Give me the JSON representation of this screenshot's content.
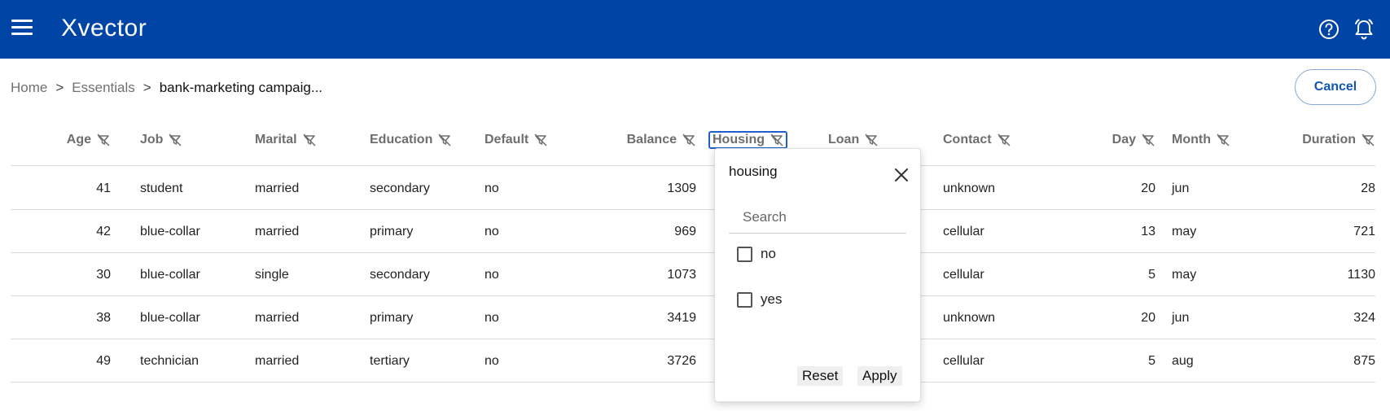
{
  "app": {
    "logo": "Xvector"
  },
  "breadcrumb": {
    "home": "Home",
    "sep": ">",
    "essentials": "Essentials",
    "current": "bank-marketing campaig..."
  },
  "actions": {
    "cancel": "Cancel"
  },
  "table": {
    "columns": [
      "Age",
      "Job",
      "Marital",
      "Education",
      "Default",
      "Balance",
      "Housing",
      "Loan",
      "Contact",
      "Day",
      "Month",
      "Duration"
    ],
    "rows": [
      [
        "41",
        "student",
        "married",
        "secondary",
        "no",
        "1309",
        "",
        "",
        "unknown",
        "20",
        "jun",
        "28"
      ],
      [
        "42",
        "blue-collar",
        "married",
        "primary",
        "no",
        "969",
        "",
        "",
        "cellular",
        "13",
        "may",
        "721"
      ],
      [
        "30",
        "blue-collar",
        "single",
        "secondary",
        "no",
        "1073",
        "",
        "",
        "cellular",
        "5",
        "may",
        "1130"
      ],
      [
        "38",
        "blue-collar",
        "married",
        "primary",
        "no",
        "3419",
        "",
        "",
        "unknown",
        "20",
        "jun",
        "324"
      ],
      [
        "49",
        "technician",
        "married",
        "tertiary",
        "no",
        "3726",
        "",
        "",
        "cellular",
        "5",
        "aug",
        "875"
      ]
    ]
  },
  "filter_popup": {
    "title": "housing",
    "search_placeholder": "Search",
    "options": [
      "no",
      "yes"
    ],
    "reset": "Reset",
    "apply": "Apply"
  },
  "icons": {
    "menu": "menu-icon",
    "help": "help-circle-icon",
    "notifications": "bell-icon",
    "filter": "filter-off-icon",
    "close": "close-icon"
  },
  "colors": {
    "header": "#0044a6",
    "accent": "#1155b8"
  }
}
